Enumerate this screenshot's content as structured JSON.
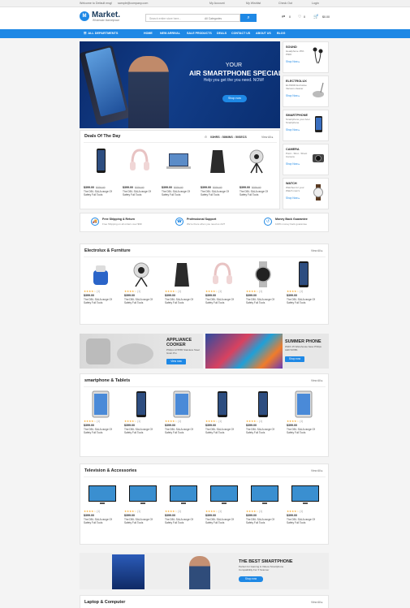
{
  "topbar": {
    "welcome": "Welcome to Default msg!",
    "email": "sample@company.com",
    "account": "My Account",
    "wishlist": "My Wishlist",
    "checkout": "Check Out",
    "login": "Login"
  },
  "header": {
    "logo_mark": "M",
    "logo": "Market.",
    "tagline": "Wholesale Marketplace",
    "search_placeholder": "Search entire store here...",
    "search_category": "All Categories",
    "wish_count": "0",
    "heart_count": "0",
    "cart_count": "0",
    "cart_total": "$0.00"
  },
  "nav": {
    "all_departments": "ALL DEPARTMENTS",
    "items": [
      "HOME",
      "NEW ARRIVAL",
      "SALE PRODUCTS",
      "DEALS",
      "CONTACT US",
      "ABOUT US",
      "BLOG"
    ]
  },
  "hero": {
    "line1": "YOUR",
    "line2": "AIR SMARTPHONE SPECIALIST",
    "line3": "Help you get the you need. NOW!",
    "button": "Shop now"
  },
  "side_promos": [
    {
      "title": "SOUND",
      "desc": "Headphone 15% P900",
      "link": "Shop Now ▸"
    },
    {
      "title": "ELECTROLUX",
      "desc": "ELX9000 Exclusive Vacuum cleaner",
      "link": "Shop Now ▸"
    },
    {
      "title": "SMARTPHONE",
      "desc": "Smartphone your Acer Smartphone",
      "link": "Shop Now ▸"
    },
    {
      "title": "CAMERA",
      "desc": "Point - Shot - Shoot Camera",
      "link": "Shop Now ▸"
    },
    {
      "title": "WATCH",
      "desc": "Watches for your Watch men's",
      "link": "Shop Now ▸"
    }
  ],
  "deals": {
    "title": "Deals Of The Day",
    "countdown": "03HRS : 58MINS : 50SECS",
    "view_all": "View All ▸",
    "products": [
      {
        "price": "$399.00",
        "old": "$320.00",
        "desc": "The DBI- SALA range Of Safety Full Tools"
      },
      {
        "price": "$399.00",
        "old": "$320.00",
        "desc": "The DBI- SALA range Of Safety Full Tools"
      },
      {
        "price": "$399.00",
        "old": "$320.00",
        "desc": "The DBI- SALA range Of Safety Full Tools"
      },
      {
        "price": "$399.00",
        "old": "$320.00",
        "desc": "The DBI- SALA range Of Safety Full Tools"
      },
      {
        "price": "$399.00",
        "old": "$320.00",
        "desc": "The DBI- SALA range Of Safety Full Tools"
      }
    ]
  },
  "features": [
    {
      "icon": "🚚",
      "title": "Free Shipping & Return",
      "desc": "Free Shipping on all orders over $99"
    },
    {
      "icon": "☎",
      "title": "Professional Support",
      "desc": "We're there when you need us 24/7"
    },
    {
      "icon": "↺",
      "title": "Money Back Guarantee",
      "desc": "100% money back guarantee"
    }
  ],
  "sections": [
    {
      "title": "Electrolux & Furniture",
      "view_all": "View All ▸"
    },
    {
      "title": "smartphone & Tablets",
      "view_all": "View All ▸"
    },
    {
      "title": "Television & Accessories",
      "view_all": "View All ▸"
    },
    {
      "title": "Laptop & Computer",
      "view_all": "View All ▸"
    }
  ],
  "product_card": {
    "stars": "★★★★☆",
    "rating_count": "(1)",
    "price": "$399.00",
    "desc": "The DBI- SALA range Of Safety Full Tools"
  },
  "banners": {
    "left_title": "APPLIANCE COOKER",
    "left_desc": "Philips HI 5565 Stainless Steel Grain Pro",
    "left_button": "View now",
    "right_title": "SUMMER PHONE",
    "right_desc": "Width 15 Warehouse base Philips LED 52XB1",
    "right_button": "Shop now"
  },
  "bottom_banner": {
    "title": "THE BEST SMARTPHONE",
    "desc": "Perfect for Gaming & Videos Smartphone Compatibility For X Scanner",
    "button": "Shop now"
  },
  "colors": {
    "accent": "#1e88e5",
    "nav": "#1e88e5",
    "star": "#f5a623"
  }
}
